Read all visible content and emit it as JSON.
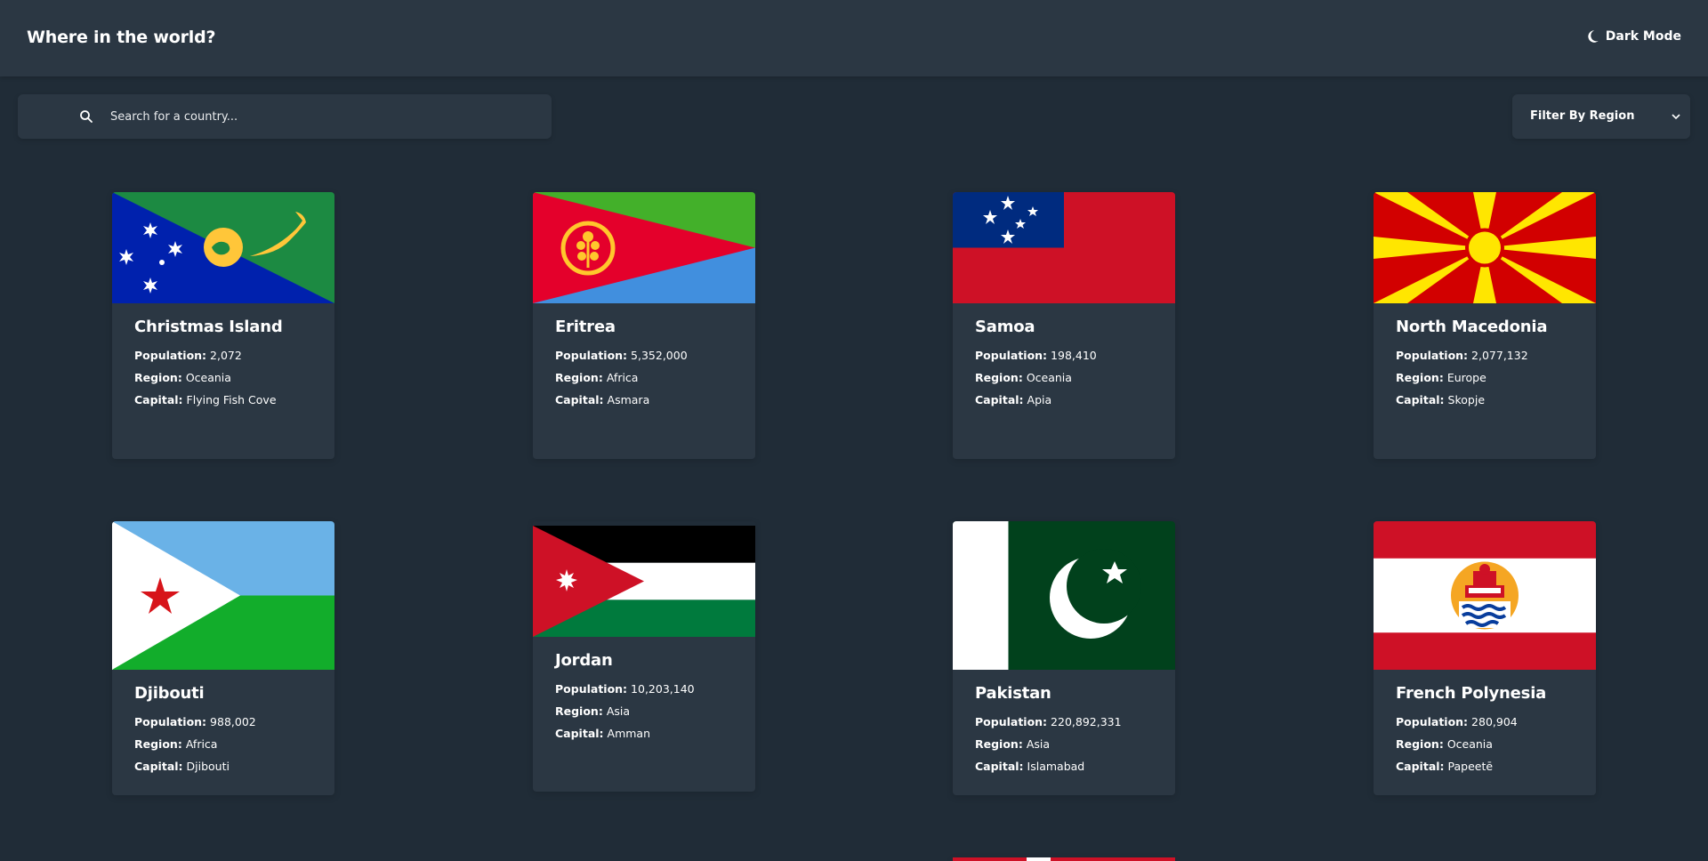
{
  "header": {
    "title": "Where in the world?",
    "mode_label": "Dark Mode"
  },
  "search": {
    "placeholder": "Search for a country..."
  },
  "filter": {
    "label": "Filter By Region"
  },
  "labels": {
    "population": "Population:",
    "region": "Region:",
    "capital": "Capital:"
  },
  "countries": [
    {
      "name": "Christmas Island",
      "population": "2,072",
      "region": "Oceania",
      "capital": "Flying Fish Cove"
    },
    {
      "name": "Eritrea",
      "population": "5,352,000",
      "region": "Africa",
      "capital": "Asmara"
    },
    {
      "name": "Samoa",
      "population": "198,410",
      "region": "Oceania",
      "capital": "Apia"
    },
    {
      "name": "North Macedonia",
      "population": "2,077,132",
      "region": "Europe",
      "capital": "Skopje"
    },
    {
      "name": "Djibouti",
      "population": "988,002",
      "region": "Africa",
      "capital": "Djibouti"
    },
    {
      "name": "Jordan",
      "population": "10,203,140",
      "region": "Asia",
      "capital": "Amman"
    },
    {
      "name": "Pakistan",
      "population": "220,892,331",
      "region": "Asia",
      "capital": "Islamabad"
    },
    {
      "name": "French Polynesia",
      "population": "280,904",
      "region": "Oceania",
      "capital": "Papeetē"
    }
  ]
}
